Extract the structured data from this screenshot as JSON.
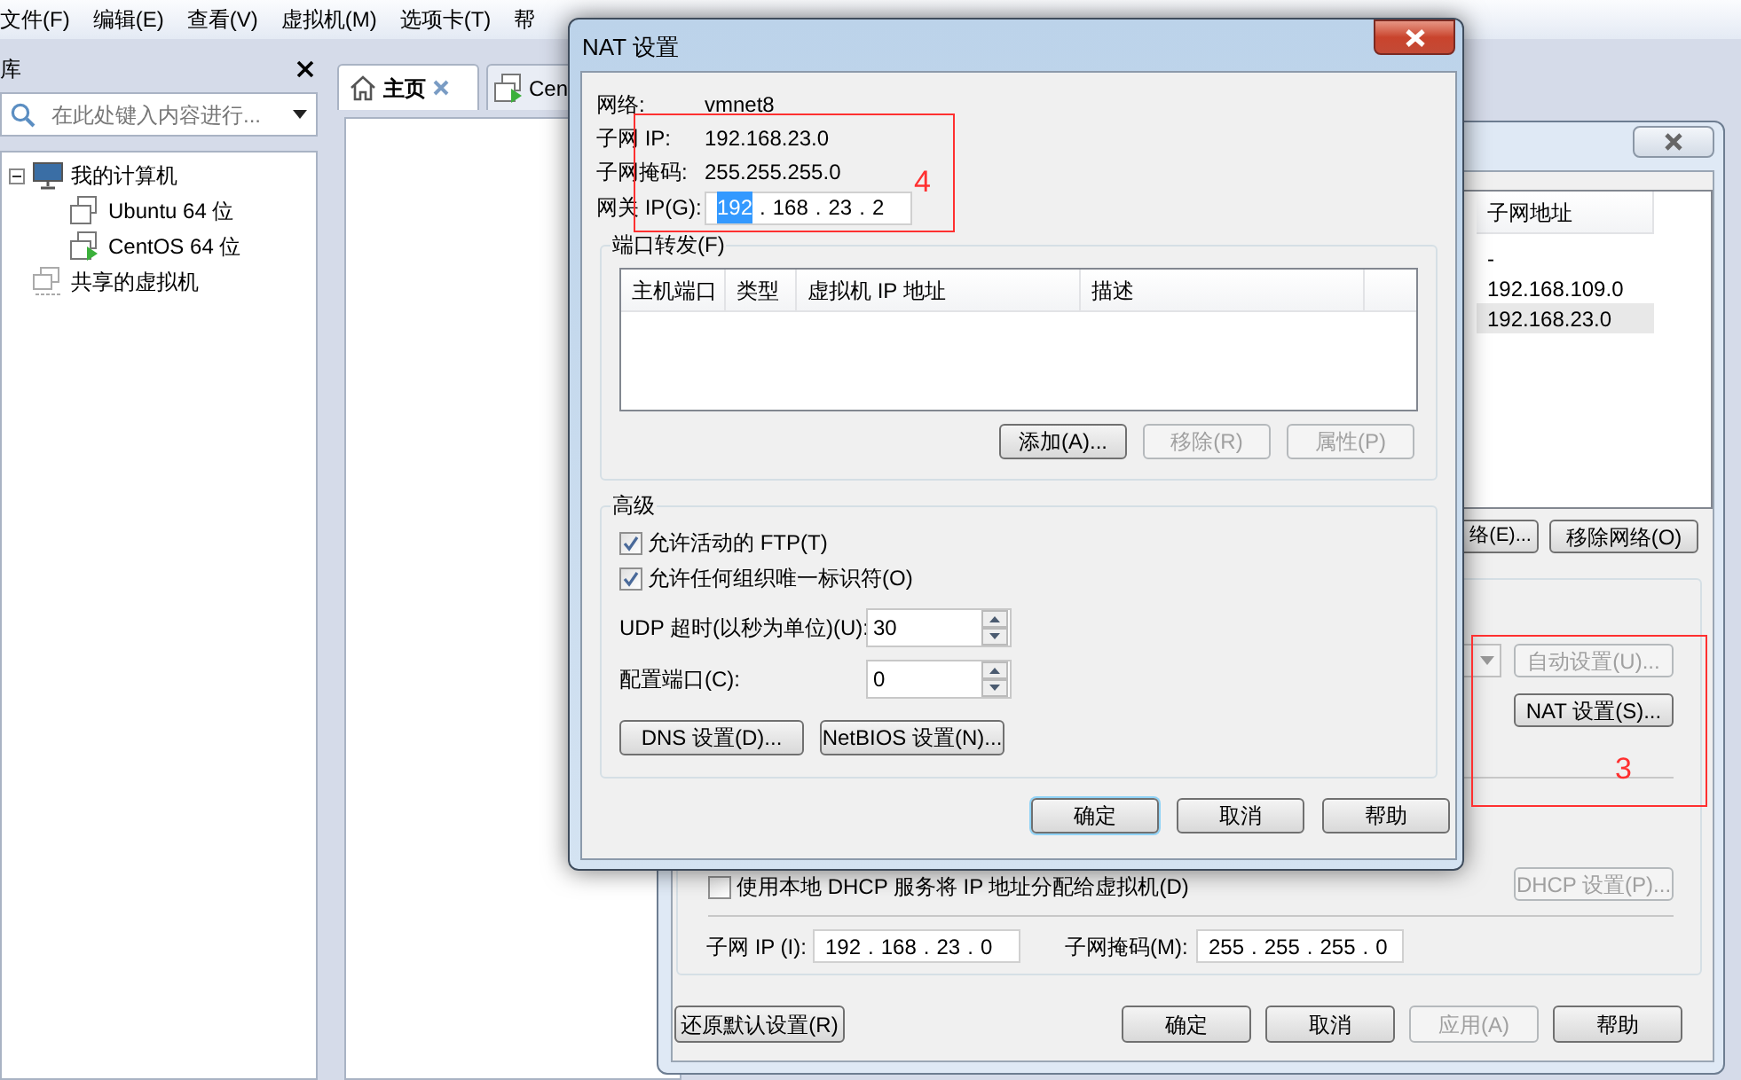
{
  "menu_bar": [
    "文件(F)",
    "编辑(E)",
    "查看(V)",
    "虚拟机(M)",
    "选项卡(T)",
    "帮"
  ],
  "library": {
    "title": "库",
    "search": {
      "placeholder": "在此处键入内容进行..."
    },
    "tree": [
      {
        "label": "我的计算机",
        "kind": "computer",
        "expanded": true,
        "children": [
          {
            "label": "Ubuntu 64 位",
            "kind": "vm",
            "running": false
          },
          {
            "label": "CentOS 64 位",
            "kind": "vm",
            "running": true
          }
        ]
      },
      {
        "label": "共享的虚拟机",
        "kind": "shared"
      }
    ]
  },
  "tabs": [
    {
      "label": "主页",
      "kind": "home",
      "selected": true
    },
    {
      "label": "Cen",
      "kind": "vm",
      "selected": false
    }
  ],
  "network_editor": {
    "table": {
      "columns": [
        "子网地址"
      ],
      "rows": [
        {
          "cells": [
            "-"
          ],
          "selected": false
        },
        {
          "cells": [
            "192.168.109.0"
          ],
          "selected": false
        },
        {
          "cells": [
            "192.168.23.0"
          ],
          "selected": true
        }
      ]
    },
    "network_buttons": [
      "络(E)...",
      "移除网络(O)"
    ],
    "auto_button": {
      "label": "自动设置(U)...",
      "disabled": true
    },
    "nat_button": {
      "label": "NAT 设置(S)...",
      "disabled": false
    },
    "dhcp": {
      "label": "使用本地 DHCP 服务将 IP 地址分配给虚拟机(D)",
      "checked": false
    },
    "dhcp_button": {
      "label": "DHCP 设置(P)...",
      "disabled": true
    },
    "subnet_ip": {
      "label": "子网 IP (I):",
      "separator": ".",
      "octets": [
        "192",
        "168",
        "23",
        "0"
      ]
    },
    "subnet_mask": {
      "label": "子网掩码(M):",
      "separator": ".",
      "octets": [
        "255",
        "255",
        "255",
        "0"
      ]
    },
    "restore_button": "还原默认设置(R)",
    "buttons": [
      {
        "label": "确定",
        "disabled": false
      },
      {
        "label": "取消",
        "disabled": false
      },
      {
        "label": "应用(A)",
        "disabled": true
      },
      {
        "label": "帮助",
        "disabled": false
      }
    ]
  },
  "nat_dialog": {
    "title": "NAT 设置",
    "info": [
      {
        "label": "网络:",
        "value": "vmnet8"
      },
      {
        "label": "子网 IP:",
        "value": "192.168.23.0"
      },
      {
        "label": "子网掩码:",
        "value": "255.255.255.0"
      }
    ],
    "gateway": {
      "label": "网关 IP(G):",
      "separator": ".",
      "octets": [
        {
          "text": "192",
          "selected": true
        },
        {
          "text": "168",
          "selected": false
        },
        {
          "text": "23",
          "selected": false
        },
        {
          "text": "2",
          "selected": false
        }
      ]
    },
    "port_forwarding": {
      "title": "端口转发(F)",
      "columns": [
        "主机端口",
        "类型",
        "虚拟机 IP 地址",
        "描述"
      ],
      "buttons": [
        {
          "label": "添加(A)...",
          "disabled": false
        },
        {
          "label": "移除(R)",
          "disabled": true
        },
        {
          "label": "属性(P)",
          "disabled": true
        }
      ]
    },
    "advanced": {
      "title": "高级",
      "checkboxes": [
        {
          "label": "允许活动的 FTP(T)",
          "checked": true
        },
        {
          "label": "允许任何组织唯一标识符(O)",
          "checked": true
        }
      ],
      "spinners": [
        {
          "label": "UDP 超时(以秒为单位)(U):",
          "value": "30"
        },
        {
          "label": "配置端口(C):",
          "value": "0"
        }
      ],
      "buttons": [
        "DNS 设置(D)...",
        "NetBIOS 设置(N)..."
      ]
    },
    "buttons": [
      {
        "label": "确定",
        "default": true
      },
      {
        "label": "取消",
        "default": false
      },
      {
        "label": "帮助",
        "default": false
      }
    ]
  },
  "annotations": [
    {
      "label": "4"
    },
    {
      "label": "3"
    }
  ]
}
